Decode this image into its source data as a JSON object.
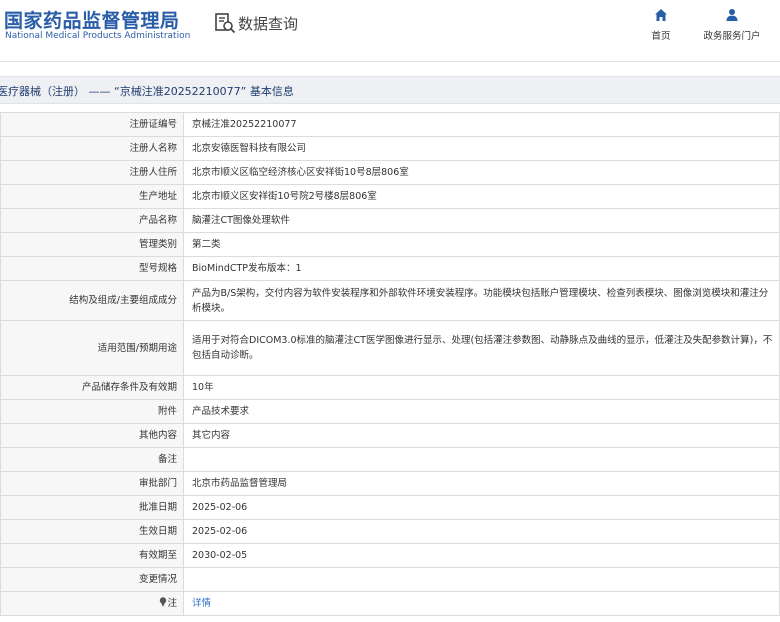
{
  "header": {
    "logo_cn": "国家药品监督管理局",
    "logo_en": "National Medical Products Administration",
    "query_label": "数据查询",
    "query_icon": "search-document-icon",
    "nav": [
      {
        "label": "首页",
        "icon": "home-icon"
      },
      {
        "label": "政务服务门户",
        "icon": "user-icon"
      }
    ],
    "brand_color": "#2a5da8"
  },
  "breadcrumb": {
    "text": "医疗器械（注册） —— “京械注准20252210077” 基本信息"
  },
  "details": [
    {
      "label": "注册证编号",
      "value": "京械注准20252210077"
    },
    {
      "label": "注册人名称",
      "value": "北京安德医智科技有限公司"
    },
    {
      "label": "注册人住所",
      "value": "北京市顺义区临空经济核心区安祥街10号8层806室"
    },
    {
      "label": "生产地址",
      "value": "北京市顺义区安祥街10号院2号楼8层806室"
    },
    {
      "label": "产品名称",
      "value": "脑灌注CT图像处理软件"
    },
    {
      "label": "管理类别",
      "value": "第二类"
    },
    {
      "label": "型号规格",
      "value": "BioMindCTP发布版本：1"
    },
    {
      "label": "结构及组成/主要组成成分",
      "value": "产品为B/S架构，交付内容为软件安装程序和外部软件环境安装程序。功能模块包括账户管理模块、检查列表模块、图像浏览模块和灌注分析模块。"
    },
    {
      "label": "适用范围/预期用途",
      "value": "适用于对符合DICOM3.0标准的脑灌注CT医学图像进行显示、处理(包括灌注参数图、动静脉点及曲线的显示，低灌注及失配参数计算)，不包括自动诊断。"
    },
    {
      "label": "产品储存条件及有效期",
      "value": "10年"
    },
    {
      "label": "附件",
      "value": "产品技术要求"
    },
    {
      "label": "其他内容",
      "value": "其它内容"
    },
    {
      "label": "备注",
      "value": ""
    },
    {
      "label": "审批部门",
      "value": "北京市药品监督管理局"
    },
    {
      "label": "批准日期",
      "value": "2025-02-06"
    },
    {
      "label": "生效日期",
      "value": "2025-02-06"
    },
    {
      "label": "有效期至",
      "value": "2030-02-05"
    },
    {
      "label": "变更情况",
      "value": ""
    },
    {
      "label": "注",
      "value": "详情",
      "icon": "pin-icon"
    }
  ]
}
